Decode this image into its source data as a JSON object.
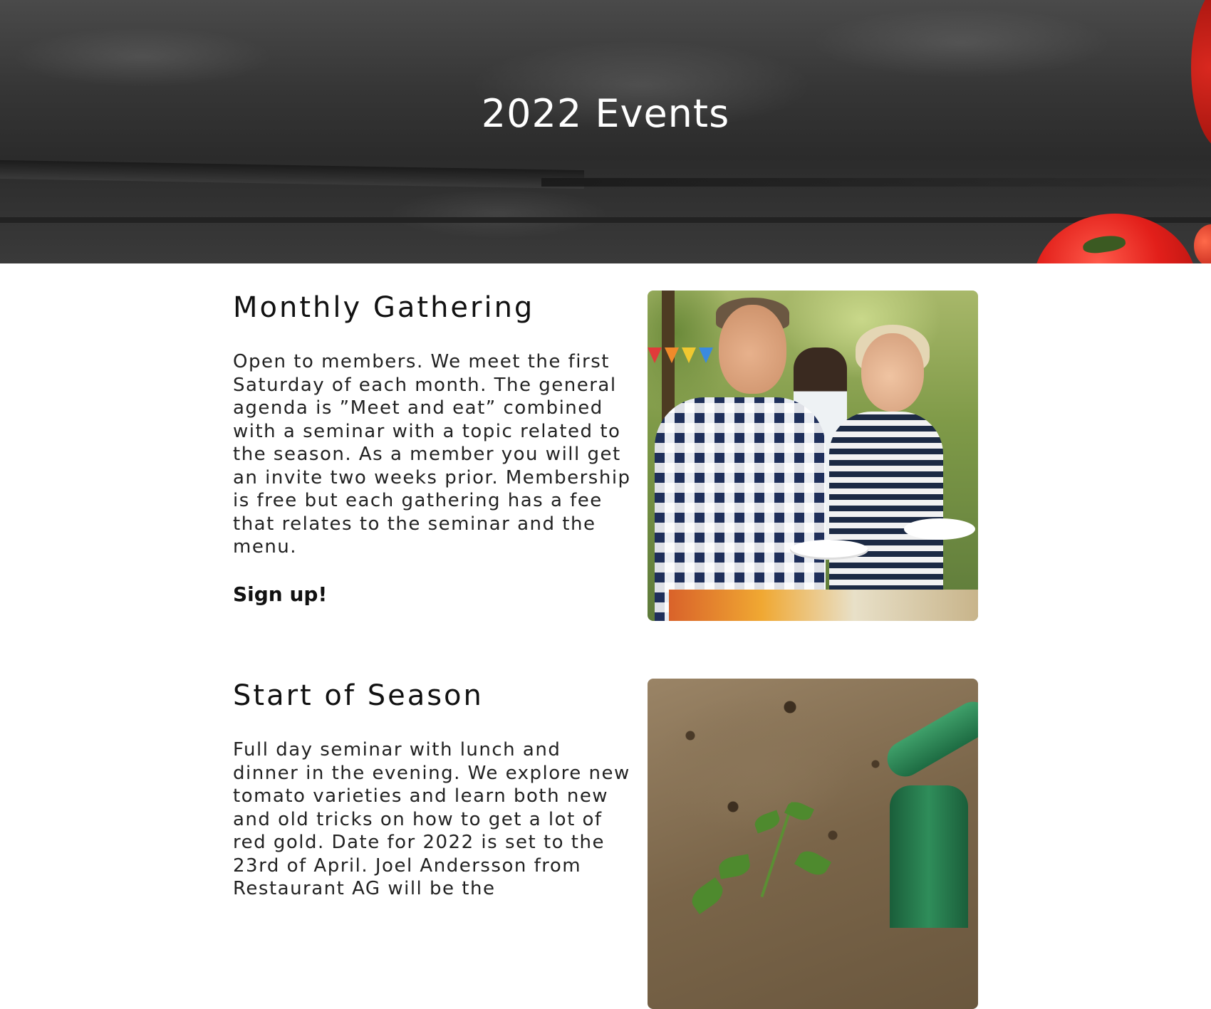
{
  "hero": {
    "title": "2022 Events"
  },
  "events": [
    {
      "title": "Monthly Gathering",
      "description": "Open to members. We meet the first Saturday of each month. The general agenda is ”Meet and eat” combined with a seminar with a topic related to the season. As a member you will get an invite two weeks prior. Membership is free but each gathering has a fee that relates to the seminar and the menu.",
      "link_label": "Sign up!",
      "image_icon": "photo-people-eating-outdoors"
    },
    {
      "title": "Start of Season",
      "description": "Full day seminar with lunch and dinner in the evening. We explore new tomato varieties and learn both new and old tricks on how to get a lot of red gold. Date for 2022 is set to the 23rd of April. Joel Andersson from Restaurant AG will be the",
      "image_icon": "photo-seedling-watering"
    }
  ],
  "colors": {
    "hero_text": "#ffffff",
    "body_text": "#111111",
    "tomato_red": "#e21f1a"
  }
}
